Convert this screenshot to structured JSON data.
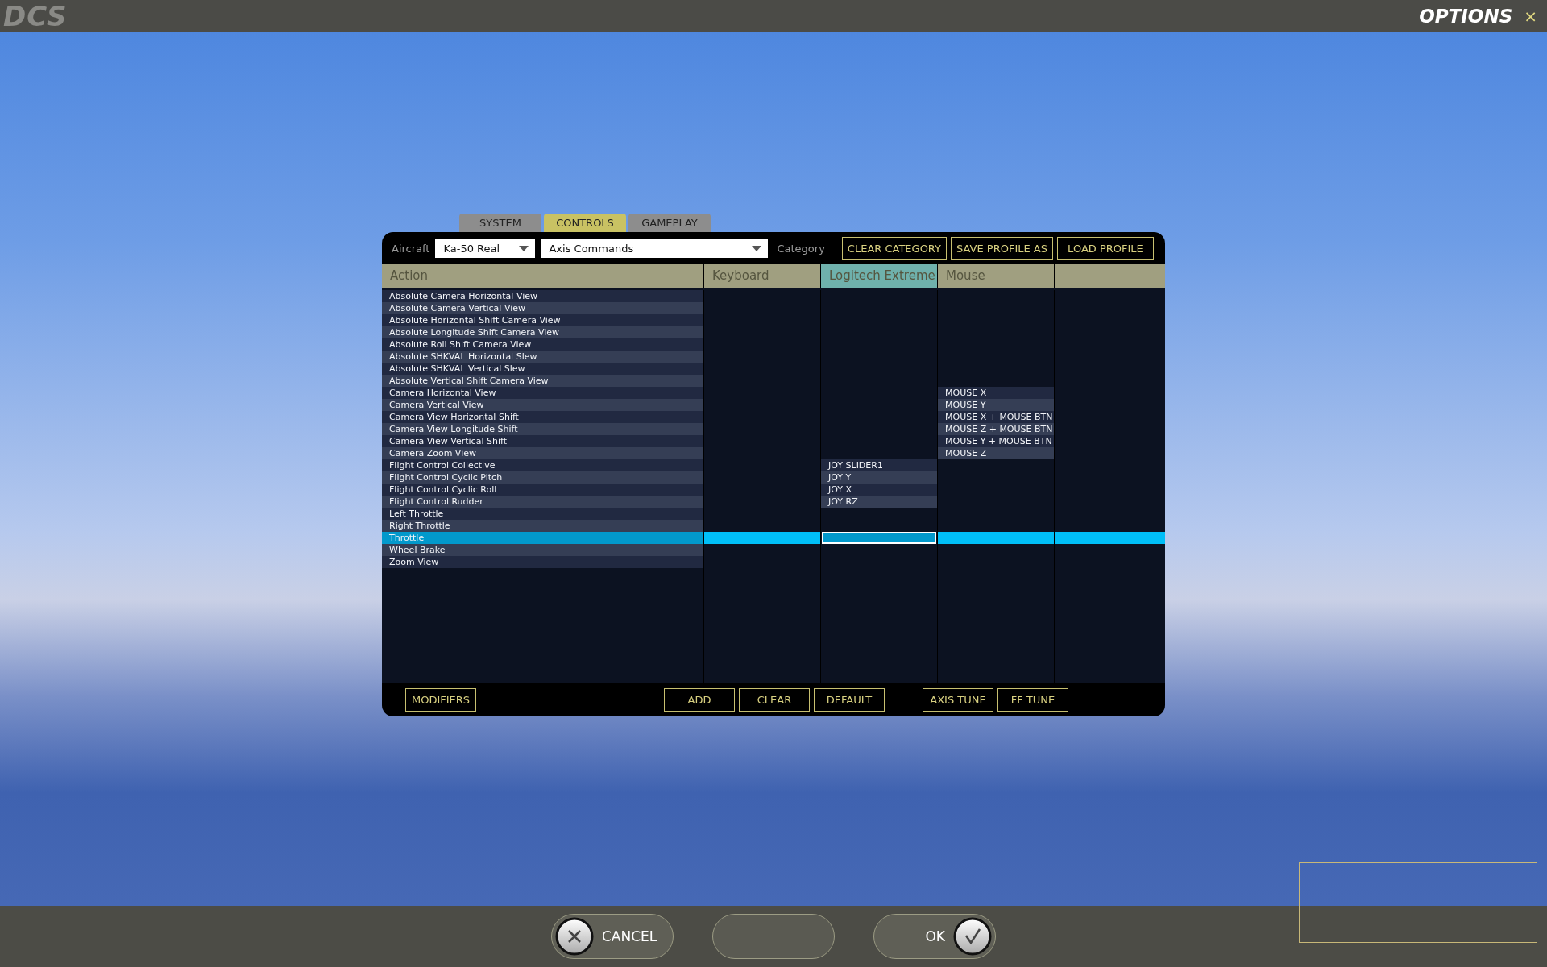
{
  "top_bar": {
    "logo": "DCS",
    "title": "OPTIONS",
    "close": "×"
  },
  "tabs": [
    {
      "label": "SYSTEM",
      "selected": false
    },
    {
      "label": "CONTROLS",
      "selected": true
    },
    {
      "label": "GAMEPLAY",
      "selected": false
    }
  ],
  "toolbar": {
    "aircraft_label": "Aircraft",
    "aircraft": "Ka-50 Real",
    "category": "Axis Commands",
    "category_label": "Category",
    "buttons": [
      "CLEAR CATEGORY",
      "SAVE PROFILE AS",
      "LOAD PROFILE"
    ]
  },
  "table": {
    "columns": [
      {
        "kind": "action",
        "label": "Action",
        "selected": false
      },
      {
        "kind": "keyboard",
        "label": "Keyboard",
        "selected": false
      },
      {
        "kind": "joystick",
        "label": "Logitech Extreme",
        "selected": true
      },
      {
        "kind": "mouse",
        "label": "Mouse",
        "selected": false
      },
      {
        "kind": "blank",
        "selected": false
      }
    ],
    "rows": [
      {
        "action": "Absolute Camera Horizontal View",
        "selected": false
      },
      {
        "action": "Absolute Camera Vertical View",
        "selected": false
      },
      {
        "action": "Absolute Horizontal Shift Camera View",
        "selected": false
      },
      {
        "action": "Absolute Longitude Shift Camera View",
        "selected": false
      },
      {
        "action": "Absolute Roll Shift Camera View",
        "selected": false
      },
      {
        "action": "Absolute SHKVAL Horizontal Slew",
        "selected": false
      },
      {
        "action": "Absolute SHKVAL Vertical Slew",
        "selected": false
      },
      {
        "action": "Absolute Vertical Shift Camera View",
        "selected": false
      },
      {
        "action": "Camera Horizontal View",
        "selected": false,
        "bindings": {
          "mouse": "MOUSE X"
        }
      },
      {
        "action": "Camera Vertical View",
        "selected": false,
        "bindings": {
          "mouse": "MOUSE Y"
        }
      },
      {
        "action": "Camera View Horizontal Shift",
        "selected": false,
        "bindings": {
          "mouse": "MOUSE X + MOUSE BTN"
        }
      },
      {
        "action": "Camera View Longitude Shift",
        "selected": false,
        "bindings": {
          "mouse": "MOUSE Z + MOUSE BTN"
        }
      },
      {
        "action": "Camera View Vertical Shift",
        "selected": false,
        "bindings": {
          "mouse": "MOUSE Y + MOUSE BTN"
        }
      },
      {
        "action": "Camera Zoom View",
        "selected": false,
        "bindings": {
          "mouse": "MOUSE Z"
        }
      },
      {
        "action": "Flight Control Collective",
        "selected": false,
        "bindings": {
          "joystick": "JOY SLIDER1"
        }
      },
      {
        "action": "Flight Control Cyclic Pitch",
        "selected": false,
        "bindings": {
          "joystick": "JOY Y"
        }
      },
      {
        "action": "Flight Control Cyclic Roll",
        "selected": false,
        "bindings": {
          "joystick": "JOY X"
        }
      },
      {
        "action": "Flight Control Rudder",
        "selected": false,
        "bindings": {
          "joystick": "JOY RZ"
        }
      },
      {
        "action": "Left Throttle",
        "selected": false
      },
      {
        "action": "Right Throttle",
        "selected": false
      },
      {
        "action": "Throttle",
        "selected": true
      },
      {
        "action": "Wheel Brake",
        "selected": false
      },
      {
        "action": "Zoom View",
        "selected": false
      }
    ]
  },
  "bottom_buttons": {
    "left": [
      "MODIFIERS"
    ],
    "center": [
      "ADD",
      "CLEAR",
      "DEFAULT"
    ],
    "right": [
      "AXIS TUNE",
      "FF TUNE"
    ]
  },
  "footer": {
    "cancel": "CANCEL",
    "ok": "OK"
  }
}
